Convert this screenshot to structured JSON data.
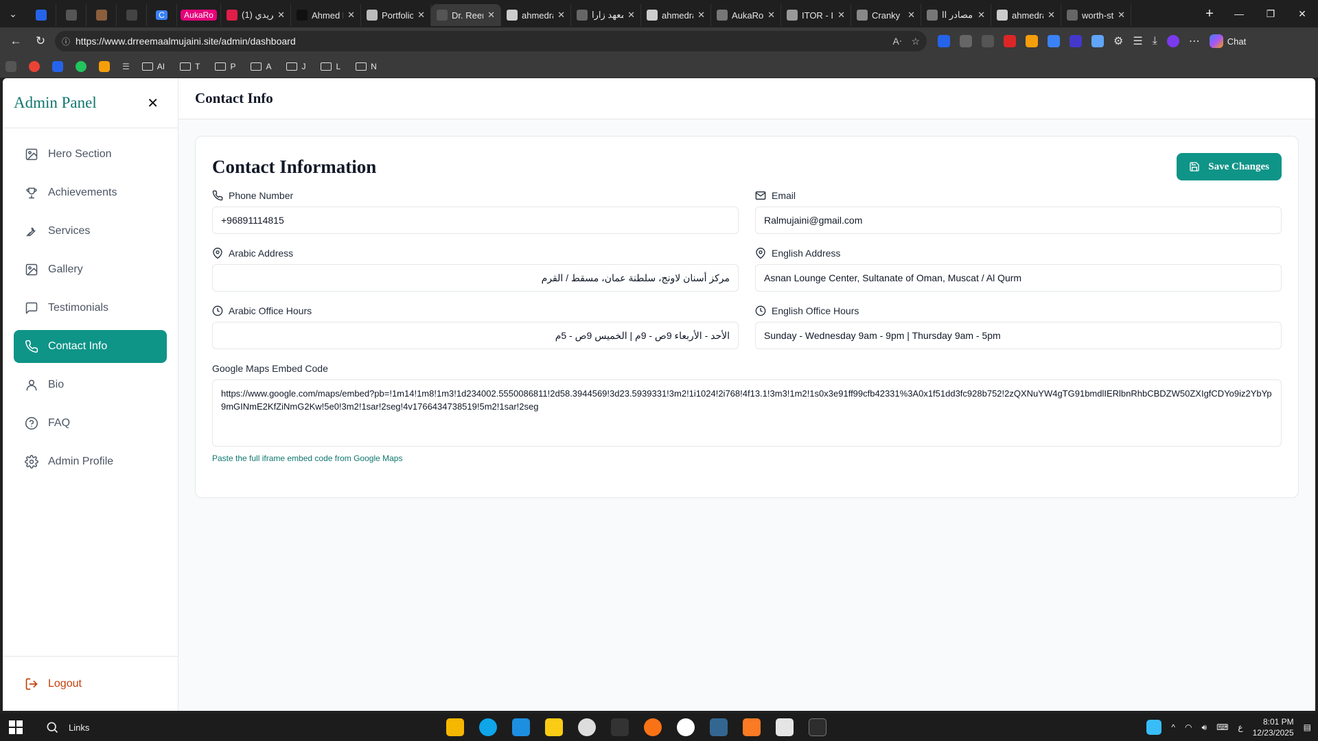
{
  "browser": {
    "tabs": [
      {
        "title": "",
        "kind": "pinned",
        "color": "#2563eb"
      },
      {
        "title": "",
        "kind": "pinned",
        "color": "#555"
      },
      {
        "title": "",
        "kind": "pinned",
        "color": "#8b5e3c"
      },
      {
        "title": "",
        "kind": "pinned",
        "color": "#444"
      },
      {
        "title": "C",
        "kind": "pinned",
        "color": "#3b82f6"
      },
      {
        "title": "AukaRo",
        "kind": "pill",
        "color": "#e6007a"
      },
      {
        "title": "(1) فريدي",
        "kind": "open",
        "color": "#e11d48"
      },
      {
        "title": "Ahmed R",
        "kind": "open",
        "color": "#111"
      },
      {
        "title": "Portfolio",
        "kind": "open",
        "color": "#bbb"
      },
      {
        "title": "Dr. Reem",
        "kind": "active",
        "color": "#555"
      },
      {
        "title": "ahmedra",
        "kind": "open",
        "color": "#ccc"
      },
      {
        "title": "معهد زارا",
        "kind": "open",
        "color": "#666"
      },
      {
        "title": "ahmedra",
        "kind": "open",
        "color": "#ccc"
      },
      {
        "title": "AukaRo",
        "kind": "open",
        "color": "#777"
      },
      {
        "title": "ITOR - Id",
        "kind": "open",
        "color": "#999"
      },
      {
        "title": "Cranky",
        "kind": "open",
        "color": "#888"
      },
      {
        "title": "مصادر اا",
        "kind": "open",
        "color": "#777"
      },
      {
        "title": "ahmedra",
        "kind": "open",
        "color": "#ccc"
      },
      {
        "title": "worth-st",
        "kind": "open",
        "color": "#666"
      }
    ],
    "url": "https://www.drreemaalmujaini.site/admin/dashboard",
    "chat_label": "Chat",
    "bookmarks": [
      {
        "label": "AI"
      },
      {
        "label": "T"
      },
      {
        "label": "P"
      },
      {
        "label": "A"
      },
      {
        "label": "J"
      },
      {
        "label": "L"
      },
      {
        "label": "N"
      }
    ]
  },
  "sidebar": {
    "title": "Admin Panel",
    "items": [
      {
        "label": "Hero Section",
        "icon": "image-icon"
      },
      {
        "label": "Achievements",
        "icon": "trophy-icon"
      },
      {
        "label": "Services",
        "icon": "wrench-icon"
      },
      {
        "label": "Gallery",
        "icon": "image-icon"
      },
      {
        "label": "Testimonials",
        "icon": "message-icon"
      },
      {
        "label": "Contact Info",
        "icon": "phone-icon",
        "active": true
      },
      {
        "label": "Bio",
        "icon": "user-icon"
      },
      {
        "label": "FAQ",
        "icon": "help-circle-icon"
      },
      {
        "label": "Admin Profile",
        "icon": "gear-icon"
      }
    ],
    "logout_label": "Logout"
  },
  "header": {
    "title": "Contact Info"
  },
  "form": {
    "title": "Contact Information",
    "save_label": "Save Changes",
    "phone": {
      "label": "Phone Number",
      "value": "+96891114815"
    },
    "email": {
      "label": "Email",
      "value": "Ralmujaini@gmail.com"
    },
    "arabic_address": {
      "label": "Arabic Address",
      "value": "مركز أسنان لاونج، سلطنة عمان، مسقط / القرم"
    },
    "english_address": {
      "label": "English Address",
      "value": "Asnan Lounge Center, Sultanate of Oman, Muscat / Al Qurm"
    },
    "arabic_hours": {
      "label": "Arabic Office Hours",
      "value": "الأحد - الأربعاء 9ص - 9م | الخميس 9ص - 5م"
    },
    "english_hours": {
      "label": "English Office Hours",
      "value": "Sunday - Wednesday 9am - 9pm | Thursday 9am - 5pm"
    },
    "maps": {
      "label": "Google Maps Embed Code",
      "value": "https://www.google.com/maps/embed?pb=!1m14!1m8!1m3!1d234002.5550086811!2d58.3944569!3d23.5939331!3m2!1i1024!2i768!4f13.1!3m3!1m2!1s0x3e91ff99cfb42331%3A0x1f51dd3fc928b752!2zQXNuYW4gTG91bmdlIERlbnRhbCBDZW50ZXIgfCDYo9iz2YbYp9mGINmE2KfZiNmG2Kw!5e0!3m2!1sar!2seg!4v1766434738519!5m2!1sar!2seg",
      "hint": "Paste the full iframe embed code from Google Maps"
    }
  },
  "taskbar": {
    "search_label": "Links",
    "time": "8:01 PM",
    "date": "12/23/2025",
    "lang": "ع"
  }
}
